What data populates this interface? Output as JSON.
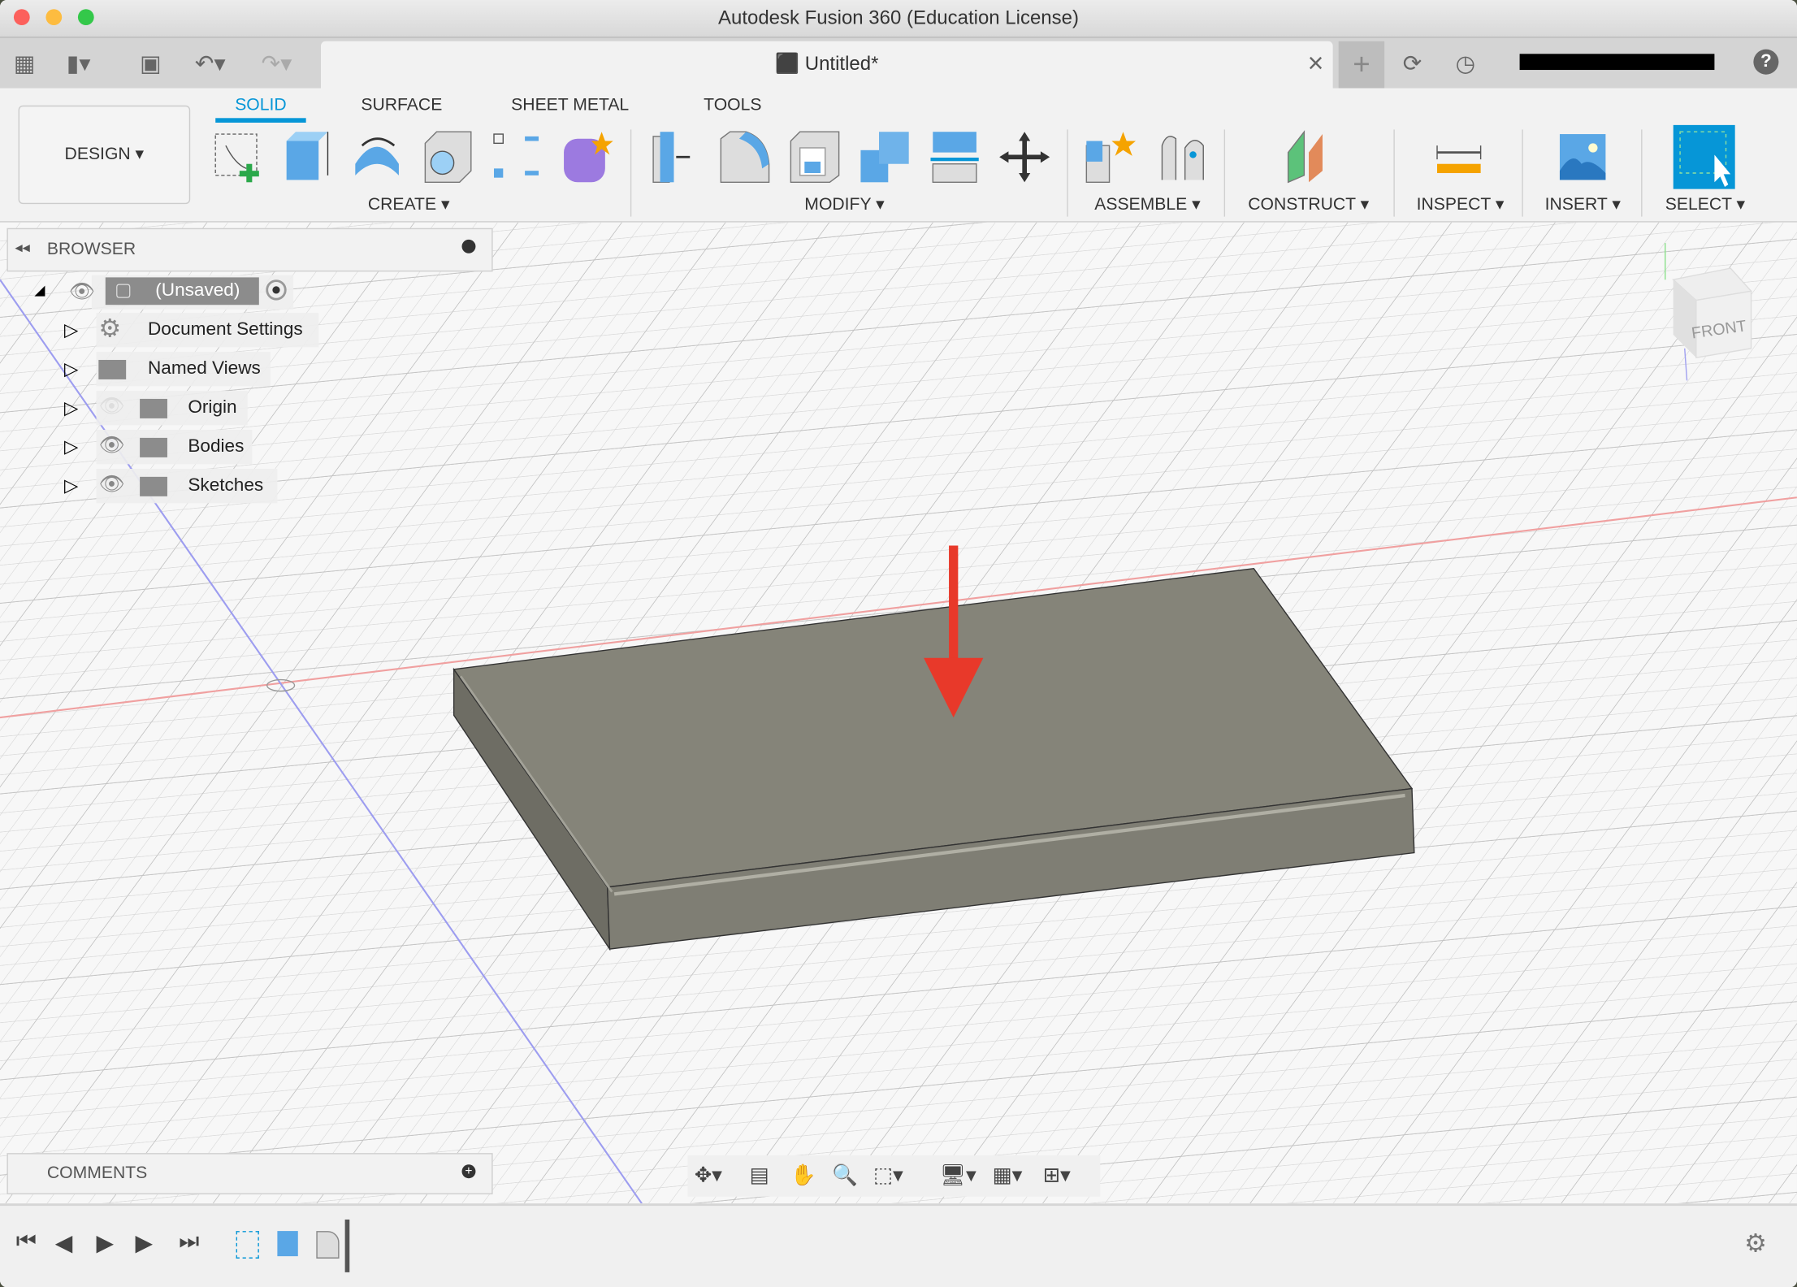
{
  "window": {
    "title": "Autodesk Fusion 360 (Education License)"
  },
  "tabbar": {
    "doc_title": "Untitled*",
    "close": "×",
    "new_tab": "+",
    "help": "?"
  },
  "ribbon": {
    "workspace": "DESIGN ▾",
    "tabs": [
      "SOLID",
      "SURFACE",
      "SHEET METAL",
      "TOOLS"
    ],
    "groups": [
      "CREATE ▾",
      "MODIFY ▾",
      "ASSEMBLE ▾",
      "CONSTRUCT ▾",
      "INSPECT ▾",
      "INSERT ▾",
      "SELECT ▾"
    ]
  },
  "browser": {
    "title": "BROWSER",
    "root": "(Unsaved)",
    "items": [
      "Document Settings",
      "Named Views",
      "Origin",
      "Bodies",
      "Sketches"
    ]
  },
  "comments": {
    "title": "COMMENTS"
  },
  "viewcube": {
    "face": "FRONT"
  },
  "colors": {
    "accent": "#0696d7",
    "arrow": "#e8392a",
    "body": "#858479"
  }
}
